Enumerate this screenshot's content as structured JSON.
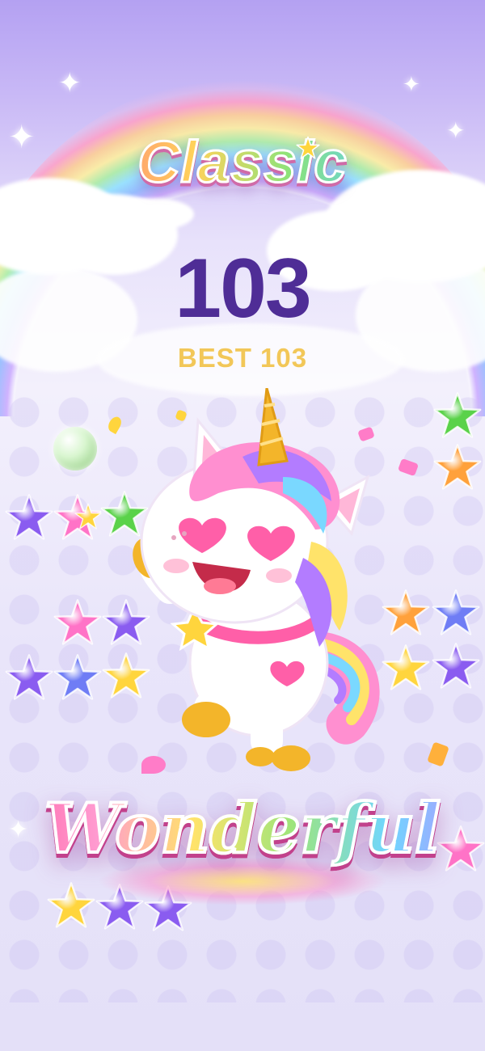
{
  "mode_title": "Classic",
  "score": "103",
  "best_label": "BEST 103",
  "praise_text": "Wonderful",
  "colors": {
    "score": "#4f2d96",
    "best": "#f2c758",
    "star_purple": "#8a5cf0",
    "star_pink": "#ff73c7",
    "star_green": "#5ad24a",
    "star_yellow": "#ffd53d",
    "star_orange": "#ffa13b",
    "star_blue": "#6f7df5"
  },
  "icons": [
    "sparkle-icon",
    "star-piece-icon",
    "bubble-icon",
    "unicorn-mascot"
  ]
}
